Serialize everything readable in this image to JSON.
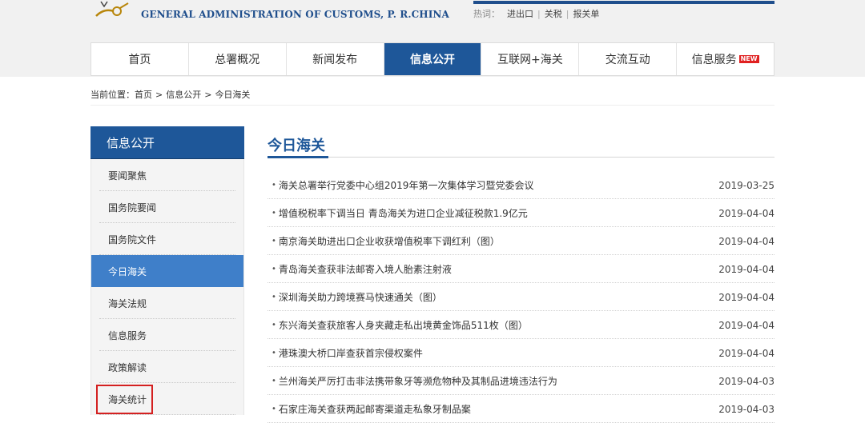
{
  "header": {
    "site_name_en": "GENERAL ADMINISTRATION OF CUSTOMS, P. R.CHINA",
    "brand_color": "#1f4e8c",
    "hot_search": {
      "label": "热词：",
      "links": [
        "进出口",
        "关税",
        "报关单"
      ]
    }
  },
  "nav": {
    "active_color": "#1e5799",
    "items": [
      {
        "label": "首页"
      },
      {
        "label": "总署概况"
      },
      {
        "label": "新闻发布"
      },
      {
        "label": "信息公开"
      },
      {
        "label": "互联网+海关"
      },
      {
        "label": "交流互动"
      },
      {
        "label": "信息服务"
      }
    ],
    "new_badge": "NEW"
  },
  "breadcrumb": {
    "prefix": "当前位置：",
    "items": [
      "首页",
      "信息公开",
      "今日海关"
    ],
    "separator": ">"
  },
  "sidebar": {
    "title": "信息公开",
    "items": [
      {
        "label": "要闻聚焦"
      },
      {
        "label": "国务院要闻"
      },
      {
        "label": "国务院文件"
      },
      {
        "label": "今日海关"
      },
      {
        "label": "海关法规"
      },
      {
        "label": "信息服务"
      },
      {
        "label": "政策解读"
      },
      {
        "label": "海关统计"
      }
    ],
    "highlight_color": "#d42020"
  },
  "content": {
    "title": "今日海关",
    "bullet": "•",
    "news": [
      {
        "title": "海关总署举行党委中心组2019年第一次集体学习暨党委会议",
        "date": "2019-03-25"
      },
      {
        "title": "增值税税率下调当日 青岛海关为进口企业减征税款1.9亿元",
        "date": "2019-04-04"
      },
      {
        "title": "南京海关助进出口企业收获增值税率下调红利（图）",
        "date": "2019-04-04"
      },
      {
        "title": "青岛海关查获非法邮寄入境人胎素注射液",
        "date": "2019-04-04"
      },
      {
        "title": "深圳海关助力跨境赛马快速通关（图）",
        "date": "2019-04-04"
      },
      {
        "title": "东兴海关查获旅客人身夹藏走私出境黄金饰品511枚（图）",
        "date": "2019-04-04"
      },
      {
        "title": "港珠澳大桥口岸查获首宗侵权案件",
        "date": "2019-04-04"
      },
      {
        "title": "兰州海关严厉打击非法携带象牙等濒危物种及其制品进境违法行为",
        "date": "2019-04-03"
      },
      {
        "title": "石家庄海关查获两起邮寄渠道走私象牙制品案",
        "date": "2019-04-03"
      }
    ]
  }
}
